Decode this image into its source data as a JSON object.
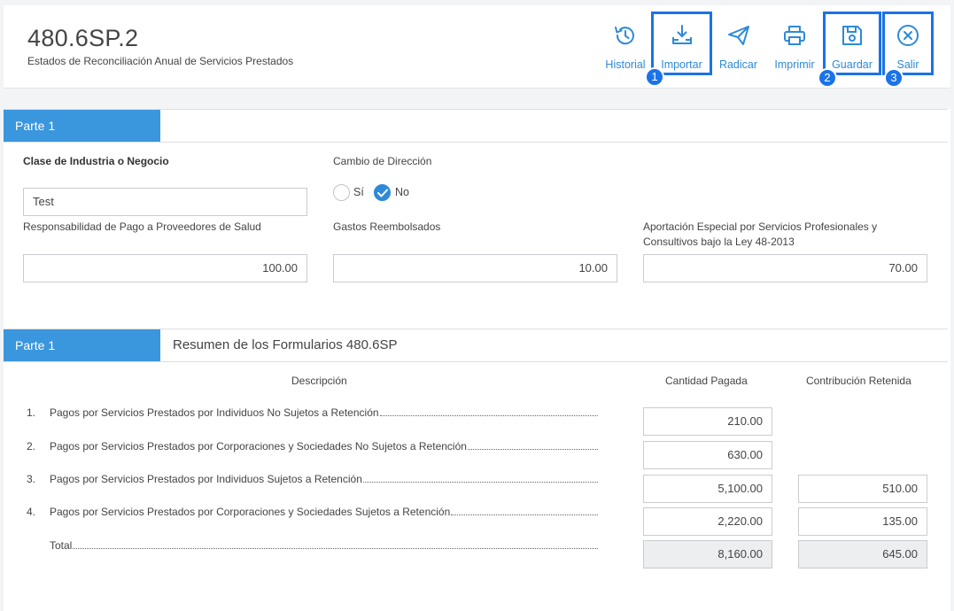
{
  "header": {
    "title": "480.6SP.2",
    "subtitle": "Estados de Reconciliación Anual de Servicios Prestados"
  },
  "toolbar": {
    "historial": "Historial",
    "importar": "Importar",
    "radicar": "Radicar",
    "imprimir": "Imprimir",
    "guardar": "Guardar",
    "salir": "Salir",
    "badges": [
      "1",
      "2",
      "3"
    ]
  },
  "parte1": {
    "tab": "Parte 1",
    "industria_label": "Clase de Industria o Negocio",
    "industria_value": "Test",
    "cambio_label": "Cambio de Dirección",
    "cambio_options": [
      "Sí",
      "No"
    ],
    "cambio_selected": "No",
    "salud_label": "Responsabilidad de Pago a Proveedores de Salud",
    "salud_value": "100.00",
    "gastos_label": "Gastos Reembolsados",
    "gastos_value": "10.00",
    "aportacion_label_1": "Aportación Especial por Servicios Profesionales y",
    "aportacion_label_2": "Consultivos bajo la Ley 48-2013",
    "aportacion_value": "70.00"
  },
  "resumen": {
    "tab": "Parte 1",
    "title": "Resumen de los Formularios 480.6SP",
    "col_desc": "Descripción",
    "col_pagada": "Cantidad Pagada",
    "col_retenida": "Contribución Retenida",
    "rows": [
      {
        "num": "1.",
        "desc": "Pagos por Servicios Prestados por Individuos No Sujetos a Retención",
        "pagada": "210.00",
        "retenida": ""
      },
      {
        "num": "2.",
        "desc": "Pagos por Servicios Prestados por Corporaciones y Sociedades No Sujetos a Retención",
        "pagada": "630.00",
        "retenida": ""
      },
      {
        "num": "3.",
        "desc": "Pagos por Servicios Prestados por Individuos Sujetos a Retención",
        "pagada": "5,100.00",
        "retenida": "510.00"
      },
      {
        "num": "4.",
        "desc": "Pagos por Servicios Prestados por Corporaciones y Sociedades Sujetos a Retención",
        "pagada": "2,220.00",
        "retenida": "135.00"
      }
    ],
    "total_label": "Total",
    "total_pagada": "8,160.00",
    "total_retenida": "645.00"
  },
  "colors": {
    "accent": "#3a96dd",
    "toolbar_text": "#2d8ad8",
    "highlight": "#1a73e8"
  }
}
